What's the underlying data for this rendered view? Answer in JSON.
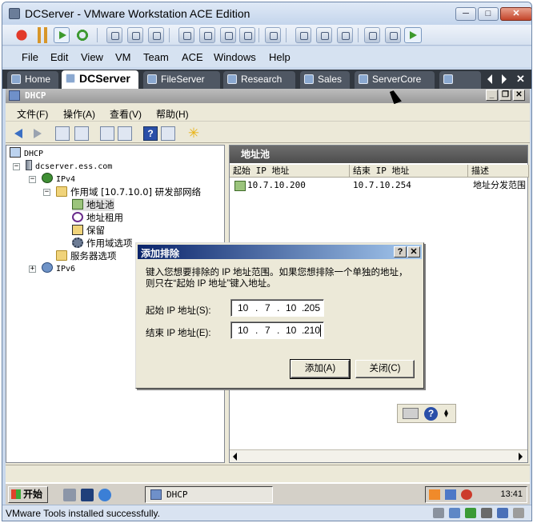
{
  "window": {
    "title": "DCServer - VMware Workstation ACE Edition",
    "minimize": "─",
    "maximize": "□",
    "close": "✕"
  },
  "menu": [
    "File",
    "Edit",
    "View",
    "VM",
    "Team",
    "ACE",
    "Windows",
    "Help"
  ],
  "tabs": [
    "Home",
    "DCServer",
    "FileServer",
    "Research",
    "Sales",
    "ServerCore",
    ""
  ],
  "active_tab": "DCServer",
  "guest_window": {
    "title": "DHCP",
    "minimize": "_",
    "restore": "❐",
    "close": "✕"
  },
  "mmc_menu": [
    "文件(F)",
    "操作(A)",
    "查看(V)",
    "帮助(H)"
  ],
  "tree": {
    "root": "DHCP",
    "server": "dcserver.ess.com",
    "ipv4": "IPv4",
    "scope": "作用域 [10.7.10.0] 研发部网络",
    "pool": "地址池",
    "leases": "地址租用",
    "reservations": "保留",
    "scope_options": "作用域选项",
    "server_options": "服务器选项",
    "ipv6": "IPv6",
    "expanded_sign": "−",
    "collapsed_sign": "+"
  },
  "list": {
    "header": "地址池",
    "columns": [
      "起始 IP 地址",
      "结束 IP 地址",
      "描述"
    ],
    "rows": [
      {
        "start": "10.7.10.200",
        "end": "10.7.10.254",
        "desc": "地址分发范围"
      }
    ]
  },
  "dialog": {
    "title": "添加排除",
    "help": "?",
    "close": "✕",
    "description": "键入您想要排除的 IP 地址范围。如果您想排除一个单独的地址，则只在“起始 IP 地址”键入地址。",
    "start_label": "起始 IP 地址(S):",
    "start_ip": [
      "10",
      "7",
      "10",
      "205"
    ],
    "end_label": "结束 IP 地址(E):",
    "end_ip": [
      "10",
      "7",
      "10",
      "210"
    ],
    "add_button": "添加(A)",
    "close_button": "关闭(C)",
    "dot": "."
  },
  "taskbar": {
    "start": "开始",
    "task": "DHCP",
    "clock": "13:41"
  },
  "status": "VMware Tools installed successfully.",
  "icons": {
    "help": "?",
    "star": "✳"
  },
  "colors": {
    "tab_bar": "#31373f",
    "dialog_title": "#0a246a",
    "list_header": "#5d5d5d"
  }
}
